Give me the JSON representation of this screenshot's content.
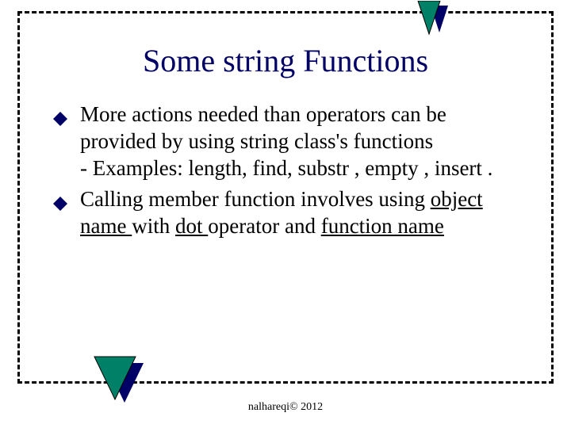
{
  "title": "Some string Functions",
  "bullets": {
    "b1": {
      "t1": "More actions needed than operators can be provided by using string class's functions",
      "t2": " - Examples: length, find, substr , empty , insert ."
    },
    "b2": {
      "t1": "Calling member function involves using ",
      "uObj": "object name ",
      "mid1": "with ",
      "uDot": "dot ",
      "mid2": "operator and ",
      "uFn": "function name"
    }
  },
  "footer": "nalhareqi© 2012",
  "colors": {
    "accent": "#000066",
    "triFront": "#008066",
    "bulletFill": "#000066"
  }
}
